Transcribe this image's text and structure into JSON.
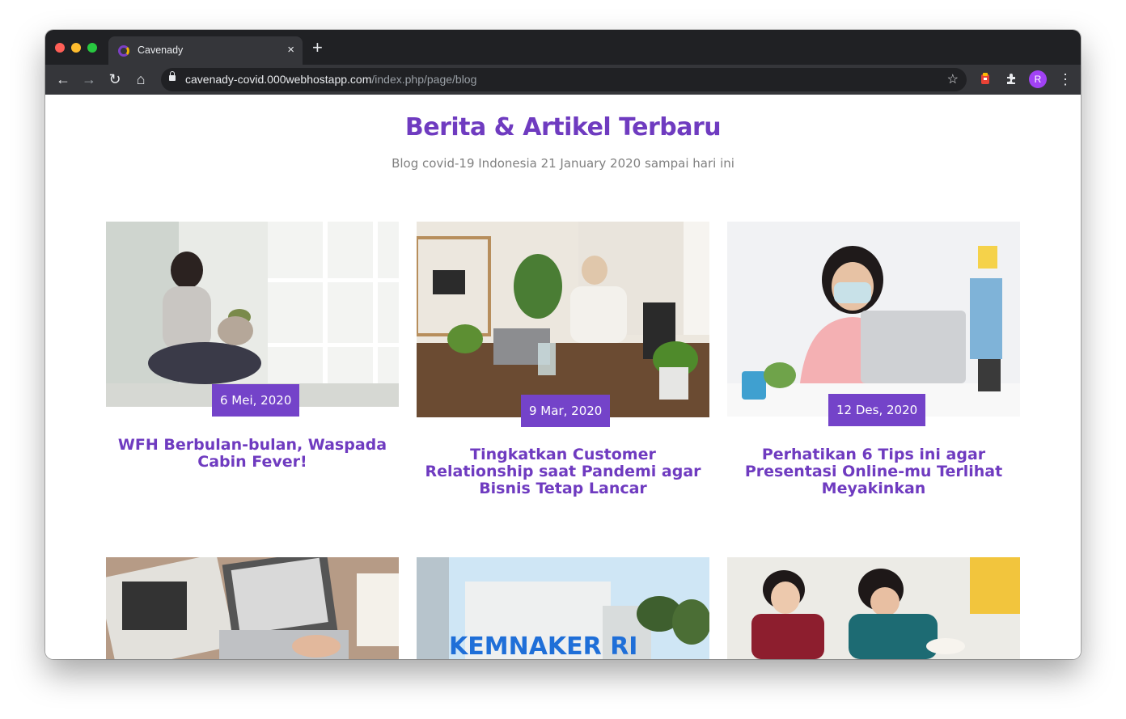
{
  "browser": {
    "tab_title": "Cavenady",
    "tab_close": "×",
    "new_tab": "+",
    "url_host": "cavenady-covid.000webhostapp.com",
    "url_path": "/index.php/page/blog",
    "avatar_initial": "R",
    "back": "←",
    "forward": "→",
    "reload": "↻",
    "home": "⌂",
    "star": "☆",
    "menu": "⋮",
    "traffic_colors": [
      "#ff5f57",
      "#febc2e",
      "#28c840"
    ]
  },
  "page": {
    "heading": "Berita & Artikel Terbaru",
    "subheading": "Blog covid-19 Indonesia 21 January 2020 sampai hari ini"
  },
  "articles": [
    {
      "date": "6 Mei, 2020",
      "title": "WFH Berbulan-bulan, Waspada Cabin Fever!"
    },
    {
      "date": "9 Mar, 2020",
      "title": "Tingkatkan Customer Relationship saat Pandemi agar Bisnis Tetap Lancar"
    },
    {
      "date": "12 Des, 2020",
      "title": "Perhatikan 6 Tips ini agar Presentasi Online-mu Terlihat Meyakinkan"
    },
    {
      "sign_text": "KEMNAKER RI"
    }
  ],
  "colors": {
    "accent": "#7443c9",
    "heading": "#6f3bc0"
  }
}
